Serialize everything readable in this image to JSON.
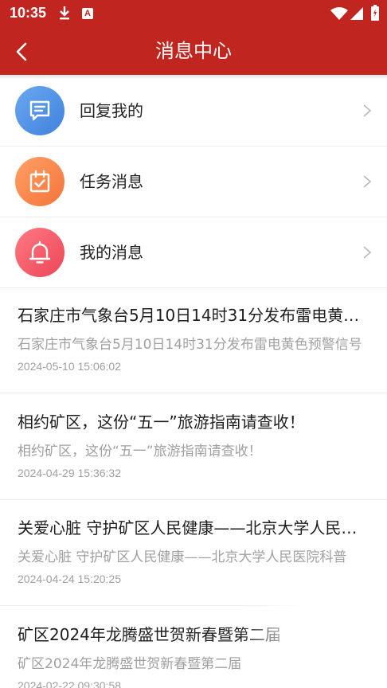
{
  "status_bar": {
    "time": "10:35",
    "icons": [
      "download-icon",
      "a-icon",
      "wifi-icon",
      "signal-icon",
      "battery-icon"
    ],
    "a_glyph": "A"
  },
  "header": {
    "title": "消息中心",
    "back_icon": "back-arrow-icon",
    "background": "#c0261f"
  },
  "menu": [
    {
      "label": "回复我的",
      "icon": "chat-icon",
      "color": "#4a8ee6"
    },
    {
      "label": "任务消息",
      "icon": "calendar-check-icon",
      "color": "#f8844a"
    },
    {
      "label": "我的消息",
      "icon": "bell-icon",
      "color": "#f2555f"
    }
  ],
  "news": [
    {
      "title": "石家庄市气象台5月10日14时31分发布雷电黄色预警信号",
      "summary": "石家庄市气象台5月10日14时31分发布雷电黄色预警信号",
      "date": "2024-05-10 15:06:02"
    },
    {
      "title": "相约矿区，这份“五一”旅游指南请查收！",
      "summary": "相约矿区，这份“五一”旅游指南请查收！",
      "date": "2024-04-29 15:36:32"
    },
    {
      "title": "关爱心脏 守护矿区人民健康——北京大学人民医院科普",
      "summary": "关爱心脏 守护矿区人民健康——北京大学人民医院科普",
      "date": "2024-04-24 15:20:25"
    },
    {
      "title": "矿区2024年龙腾盛世贺新春暨第二届",
      "summary": "矿区2024年龙腾盛世贺新春暨第二届",
      "date": "2024-02-22 09:30:58"
    }
  ]
}
